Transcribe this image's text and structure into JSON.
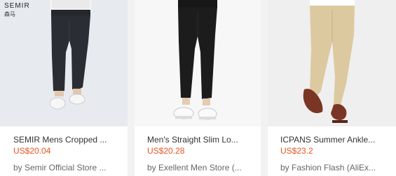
{
  "products": [
    {
      "brand_logo": "SEMIR",
      "brand_logo_sub": "森马",
      "title": "SEMIR Mens Cropped ...",
      "price": "US$20.04",
      "store": "by Semir Official Store ..."
    },
    {
      "title": "Men's Straight Slim Lo...",
      "price": "US$20.28",
      "store": "by Exellent Men Store (..."
    },
    {
      "title": "ICPANS Summer Ankle...",
      "price": "US$23.2",
      "store": "by Fashion Flash (AliEx..."
    }
  ],
  "colors": {
    "price": "#e8541f",
    "pants_card1": "#2a2d33",
    "pants_card2": "#1c1c1c",
    "pants_card3": "#dcc9a0"
  }
}
